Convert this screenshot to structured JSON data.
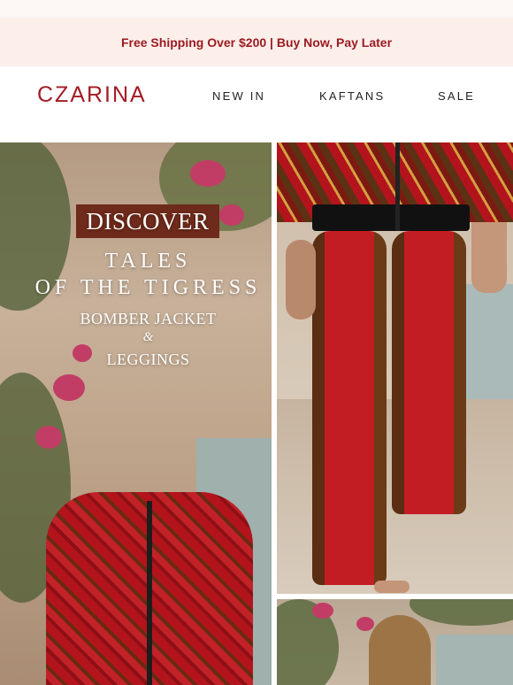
{
  "promo": {
    "text": "Free Shipping Over $200 | Buy Now, Pay Later"
  },
  "header": {
    "logo": "CZARINA",
    "nav": [
      "NEW IN",
      "KAFTANS",
      "SALE"
    ]
  },
  "hero": {
    "badge": "DISCOVER",
    "title_line1": "TALES",
    "title_line2": "OF THE TIGRESS",
    "product1": "BOMBER JACKET",
    "ampersand": "&",
    "product2": "LEGGINGS"
  },
  "colors": {
    "brand": "#a31c24",
    "promo_bg": "#fcefea",
    "promo_text": "#9b1b22",
    "badge_bg": "#6e2a1a"
  }
}
